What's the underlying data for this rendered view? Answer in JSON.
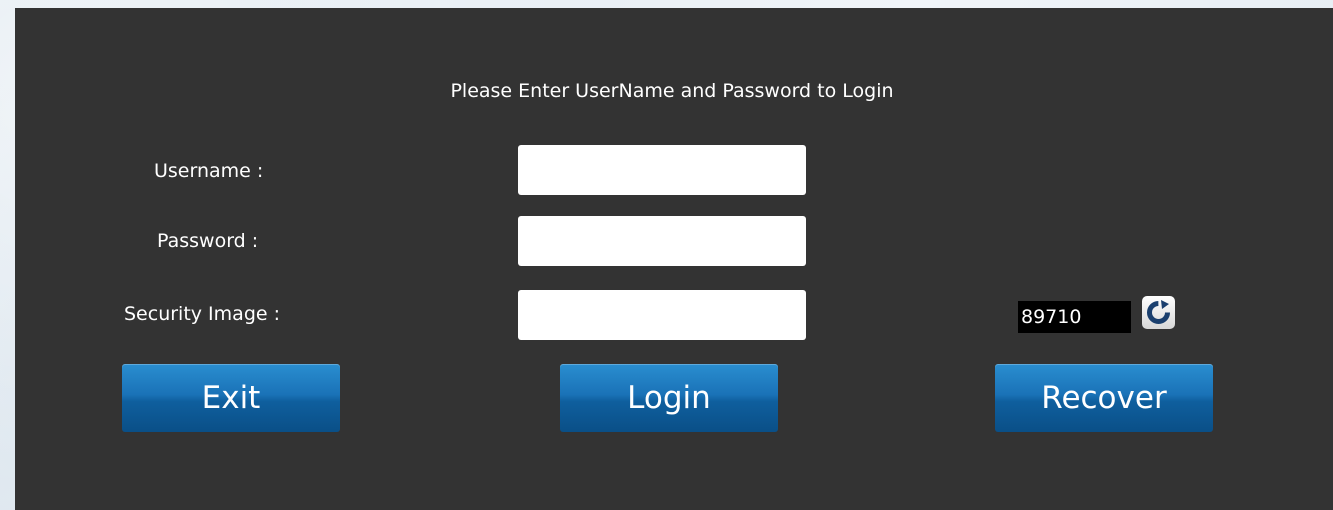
{
  "login": {
    "title": "Please Enter UserName and Password to Login",
    "username_label": "Username :",
    "username_value": "",
    "password_label": "Password :",
    "password_value": "",
    "security_label": "Security Image :",
    "security_value": "",
    "captcha_text": "89710",
    "refresh_icon": "refresh-icon"
  },
  "buttons": {
    "exit": "Exit",
    "login": "Login",
    "recover": "Recover"
  },
  "colors": {
    "panel": "#333333",
    "button": "#1a72b7"
  }
}
